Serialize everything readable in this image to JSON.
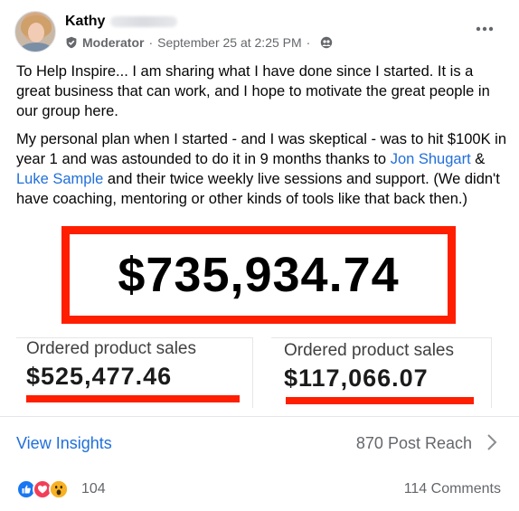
{
  "post": {
    "author_name": "Kathy",
    "role": "Moderator",
    "separator": "·",
    "timestamp": "September 25 at 2:25 PM",
    "separator2": "·",
    "paragraph1": "To Help Inspire... I am sharing what I have done since I started. It is a great business that can work, and I hope to motivate the great people in our group here.",
    "paragraph2_part1": "My personal plan when I started - and I was skeptical - was to hit $100K in year 1 and was astounded to do it in 9 months thanks to ",
    "mention1": "Jon Shugart",
    "paragraph2_part2": " & ",
    "mention2": "Luke Sample",
    "paragraph2_part3": " and their twice weekly live sessions and support. (We didn't have coaching, mentoring or other kinds of tools like that back then.)"
  },
  "image": {
    "total": "$735,934.74",
    "sales": [
      {
        "label": "Ordered product sales",
        "value": "$525,477.46"
      },
      {
        "label": "Ordered product sales",
        "value": "$117,066.07"
      }
    ],
    "accent_color": "#ff1e00"
  },
  "insights": {
    "link_label": "View Insights",
    "reach": "870 Post Reach"
  },
  "reactions": {
    "icons": [
      "like-icon",
      "love-icon",
      "wow-icon"
    ],
    "count": "104",
    "comments": "114 Comments"
  },
  "colors": {
    "link": "#216fdb",
    "secondary_text": "#65676b"
  }
}
